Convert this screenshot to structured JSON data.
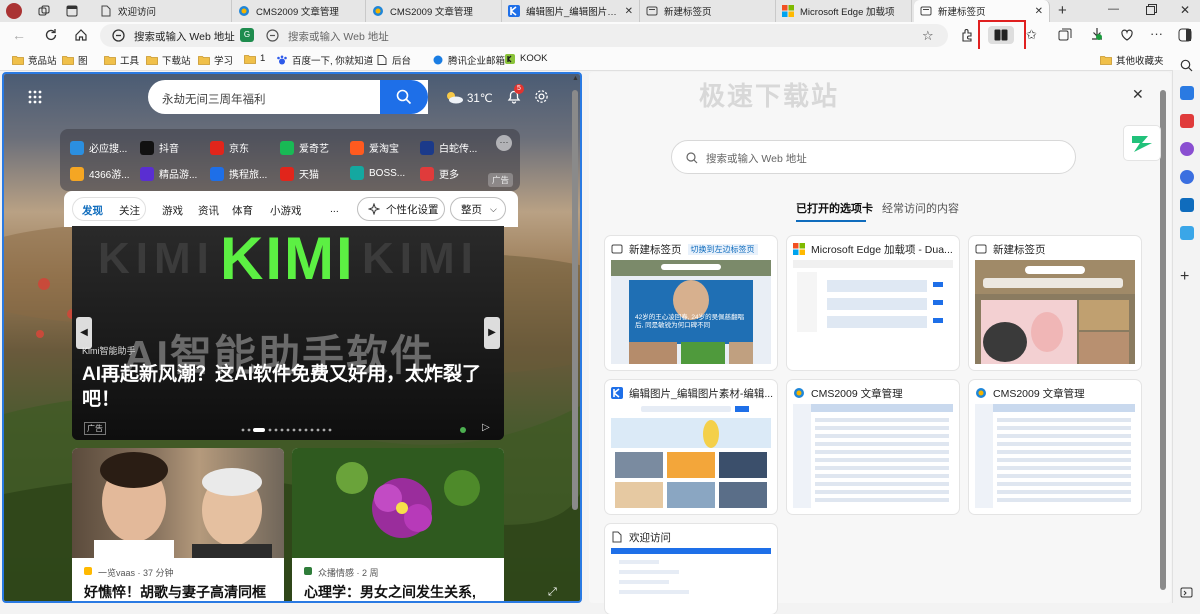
{
  "tabs": [
    {
      "label": "欢迎访问",
      "active": false
    },
    {
      "label": "CMS2009 文章管理",
      "active": false
    },
    {
      "label": "CMS2009 文章管理",
      "active": false
    },
    {
      "label": "编辑图片_编辑图片素材",
      "active": false
    },
    {
      "label": "新建标签页",
      "active": false
    },
    {
      "label": "Microsoft Edge 加载项",
      "active": false
    },
    {
      "label": "新建标签页",
      "active": true
    }
  ],
  "address": {
    "omnibox_text": "搜索或输入 Web 地址",
    "placeholder": "搜索或输入 Web 地址"
  },
  "split_label": "分屏",
  "bookmarks": [
    "竞品站",
    "图",
    "工具",
    "下载站",
    "学习",
    "1",
    "百度一下, 你就知道",
    "后台",
    "腾讯企业邮箱",
    "KOOK"
  ],
  "other_bookmarks": "其他收藏夹",
  "left_pane": {
    "search_placeholder": "永劫无间三周年福利",
    "weather": "31℃",
    "notif_count": "5",
    "quick_links": [
      {
        "label": "必应搜..."
      },
      {
        "label": "抖音"
      },
      {
        "label": "京东"
      },
      {
        "label": "爱奇艺"
      },
      {
        "label": "爱淘宝"
      },
      {
        "label": "白蛇传..."
      },
      {
        "label": "4366游..."
      },
      {
        "label": "精品游..."
      },
      {
        "label": "携程旅..."
      },
      {
        "label": "天猫"
      },
      {
        "label": "BOSS..."
      },
      {
        "label": "更多"
      }
    ],
    "ad_badge": "广告",
    "feed_tabs": [
      "发现",
      "关注",
      "游戏",
      "资讯",
      "体育",
      "小游戏",
      "..."
    ],
    "personalize": "个性化设置",
    "layout_btn": "整页",
    "hero": {
      "banner_word": "KIMI",
      "banner_sub": "AI智能助手软件",
      "source": "Kimi智能助手",
      "title": "AI再起新风潮？这AI软件免费又好用，太炸裂了吧！",
      "ad": "广告"
    },
    "news": [
      {
        "source": "一览vaas",
        "time": "37 分钟",
        "title": "好憔悴！胡歌与妻子高清同框"
      },
      {
        "source": "众播情感",
        "time": "2 周",
        "title": "心理学：男女之间发生关系,"
      }
    ]
  },
  "right_pane": {
    "watermark": "极速下载站",
    "search_placeholder": "搜索或输入 Web 地址",
    "tab_open": "已打开的选项卡",
    "tab_frequent": "经常访问的内容",
    "cards": [
      {
        "title": "新建标签页",
        "badge": "切换到左边标签页"
      },
      {
        "title": "Microsoft Edge 加载项 - Dua..."
      },
      {
        "title": "新建标签页"
      },
      {
        "title": "编辑图片_编辑图片素材-编辑..."
      },
      {
        "title": "CMS2009 文章管理"
      },
      {
        "title": "CMS2009 文章管理"
      },
      {
        "title": "欢迎访问"
      }
    ],
    "thumb_caption": "42岁的王心凌回春, 24岁的吴佩慈翻唱后, 同是敏锐为何口碑不同"
  },
  "colors": {
    "accent": "#0f6cbd",
    "split_red": "#e02020",
    "kimi_green": "#5cf043"
  }
}
